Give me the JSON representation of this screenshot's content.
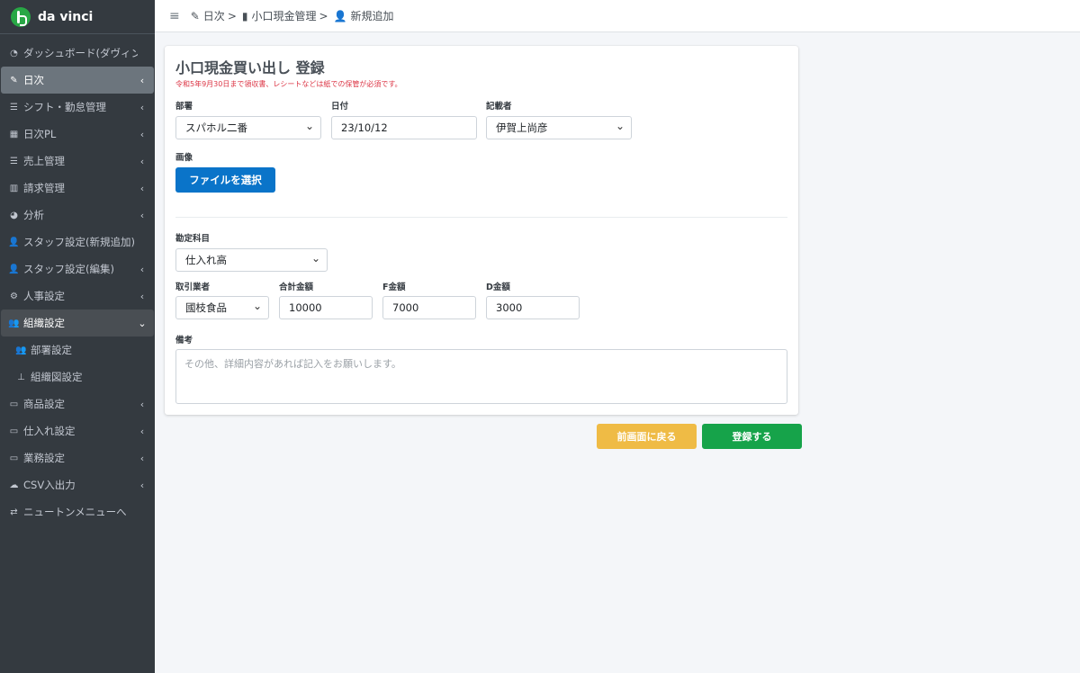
{
  "brand": {
    "name": "da vinci"
  },
  "sidebar": {
    "items": [
      {
        "icon": "dashboard-icon",
        "glyph": "◔",
        "label": "ダッシュボード(ダヴィンチ)",
        "chevron": ""
      },
      {
        "icon": "edit-icon",
        "glyph": "✎",
        "label": "日次",
        "chevron": "‹"
      },
      {
        "icon": "list-icon",
        "glyph": "☰",
        "label": "シフト・勤怠管理",
        "chevron": "‹"
      },
      {
        "icon": "calculator-icon",
        "glyph": "▦",
        "label": "日次PL",
        "chevron": "‹"
      },
      {
        "icon": "list-icon",
        "glyph": "☰",
        "label": "売上管理",
        "chevron": "‹"
      },
      {
        "icon": "calendar-icon",
        "glyph": "▥",
        "label": "請求管理",
        "chevron": "‹"
      },
      {
        "icon": "pie-chart-icon",
        "glyph": "◕",
        "label": "分析",
        "chevron": "‹"
      },
      {
        "icon": "user-plus-icon",
        "glyph": "👤",
        "label": "スタッフ設定(新規追加)",
        "chevron": ""
      },
      {
        "icon": "user-edit-icon",
        "glyph": "👤",
        "label": "スタッフ設定(編集)",
        "chevron": "‹"
      },
      {
        "icon": "gear-icon",
        "glyph": "⚙",
        "label": "人事設定",
        "chevron": "‹"
      },
      {
        "icon": "users-icon",
        "glyph": "👥",
        "label": "組織設定",
        "chevron": "⌄"
      },
      {
        "icon": "users-icon",
        "glyph": "👥",
        "label": "部署設定",
        "chevron": ""
      },
      {
        "icon": "sitemap-icon",
        "glyph": "⊥",
        "label": "組織図設定",
        "chevron": ""
      },
      {
        "icon": "store-icon",
        "glyph": "▭",
        "label": "商品設定",
        "chevron": "‹"
      },
      {
        "icon": "store-icon",
        "glyph": "▭",
        "label": "仕入れ設定",
        "chevron": "‹"
      },
      {
        "icon": "store-icon",
        "glyph": "▭",
        "label": "業務設定",
        "chevron": "‹"
      },
      {
        "icon": "cloud-icon",
        "glyph": "☁",
        "label": "CSV入出力",
        "chevron": "‹"
      },
      {
        "icon": "exchange-icon",
        "glyph": "⇄",
        "label": "ニュートンメニューへ",
        "chevron": ""
      }
    ]
  },
  "breadcrumb": {
    "menu_glyph": "≡",
    "items": [
      {
        "icon": "edit-icon",
        "glyph": "✎",
        "label": "日次",
        "sep": ">"
      },
      {
        "icon": "file-icon",
        "glyph": "▮",
        "label": "小口現金管理",
        "sep": ">"
      },
      {
        "icon": "user-plus-icon",
        "glyph": "👤",
        "label": "新規追加",
        "sep": ""
      }
    ]
  },
  "form": {
    "title": "小口現金買い出し 登録",
    "note": "令和5年9月30日まで領収書、レシートなどは紙での保管が必須です。",
    "department": {
      "label": "部署",
      "value": "スパホル二番"
    },
    "date": {
      "label": "日付",
      "value": "23/10/12"
    },
    "writer": {
      "label": "記載者",
      "value": "伊賀上尚彦"
    },
    "image": {
      "label": "画像",
      "button": "ファイルを選択"
    },
    "account": {
      "label": "勘定科目",
      "value": "仕入れ高"
    },
    "vendor": {
      "label": "取引業者",
      "value": "國枝食品"
    },
    "total": {
      "label": "合計金額",
      "value": "10000"
    },
    "f_amount": {
      "label": "F金額",
      "value": "7000"
    },
    "d_amount": {
      "label": "D金額",
      "value": "3000"
    },
    "remarks": {
      "label": "備考",
      "placeholder": "その他、詳細内容があれば記入をお願いします。"
    }
  },
  "actions": {
    "back": "前画面に戻る",
    "submit": "登録する"
  },
  "colors": {
    "sidebar": "#343a40",
    "primary": "#0a74c9",
    "warning": "#efbb45",
    "success": "#16a34a",
    "note": "#dc3545"
  }
}
